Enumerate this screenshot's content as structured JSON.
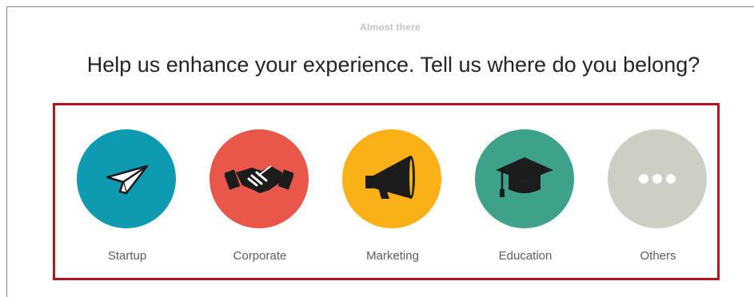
{
  "header": {
    "step_label": "Almost there",
    "question": "Help us enhance your experience. Tell us where do you belong?"
  },
  "options": [
    {
      "label": "Startup",
      "icon": "paper-plane-icon",
      "color": "#0e9ab0"
    },
    {
      "label": "Corporate",
      "icon": "handshake-icon",
      "color": "#e8574a"
    },
    {
      "label": "Marketing",
      "icon": "megaphone-icon",
      "color": "#f9b117"
    },
    {
      "label": "Education",
      "icon": "graduation-cap-icon",
      "color": "#3ea18a"
    },
    {
      "label": "Others",
      "icon": "more-dots-icon",
      "color": "#cccfc3"
    }
  ],
  "highlight_color": "#b3161c"
}
